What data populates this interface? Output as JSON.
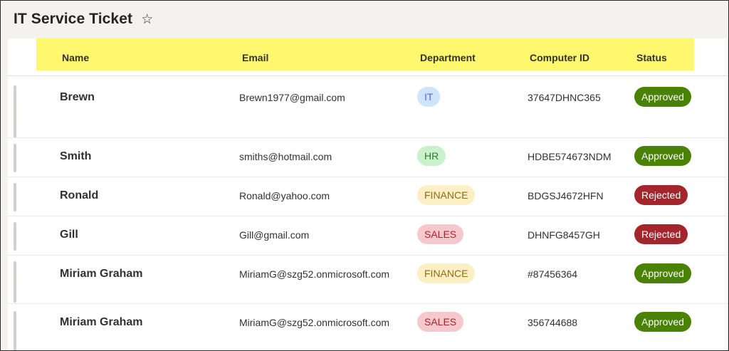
{
  "header": {
    "title": "IT Service Ticket",
    "favorite_icon": "star-icon"
  },
  "table": {
    "columns": [
      "Name",
      "Email",
      "Department",
      "Computer ID",
      "Status"
    ],
    "header_color": "#fff86f",
    "rows": [
      {
        "name": "Brewn",
        "email": "Brewn1977@gmail.com",
        "department": "IT",
        "computer_id": "37647DHNC365",
        "status": "Approved"
      },
      {
        "name": "Smith",
        "email": "smiths@hotmail.com",
        "department": "HR",
        "computer_id": "HDBE574673NDM",
        "status": "Approved"
      },
      {
        "name": "Ronald",
        "email": "Ronald@yahoo.com",
        "department": "FINANCE",
        "computer_id": "BDGSJ4672HFN",
        "status": "Rejected"
      },
      {
        "name": "Gill",
        "email": "Gill@gmail.com",
        "department": "SALES",
        "computer_id": "DHNFG8457GH",
        "status": "Rejected"
      },
      {
        "name": "Miriam Graham",
        "email": "MiriamG@szg52.onmicrosoft.com",
        "department": "FINANCE",
        "computer_id": "#87456364",
        "status": "Approved"
      },
      {
        "name": "Miriam Graham",
        "email": "MiriamG@szg52.onmicrosoft.com",
        "department": "SALES",
        "computer_id": "356744688",
        "status": "Approved"
      }
    ]
  },
  "colors": {
    "approved": "#498205",
    "rejected": "#a4262c",
    "dept_it": "#cfe4fa",
    "dept_hr": "#caf0cc",
    "dept_finance": "#fcefc4",
    "dept_sales": "#f6c8ce"
  }
}
